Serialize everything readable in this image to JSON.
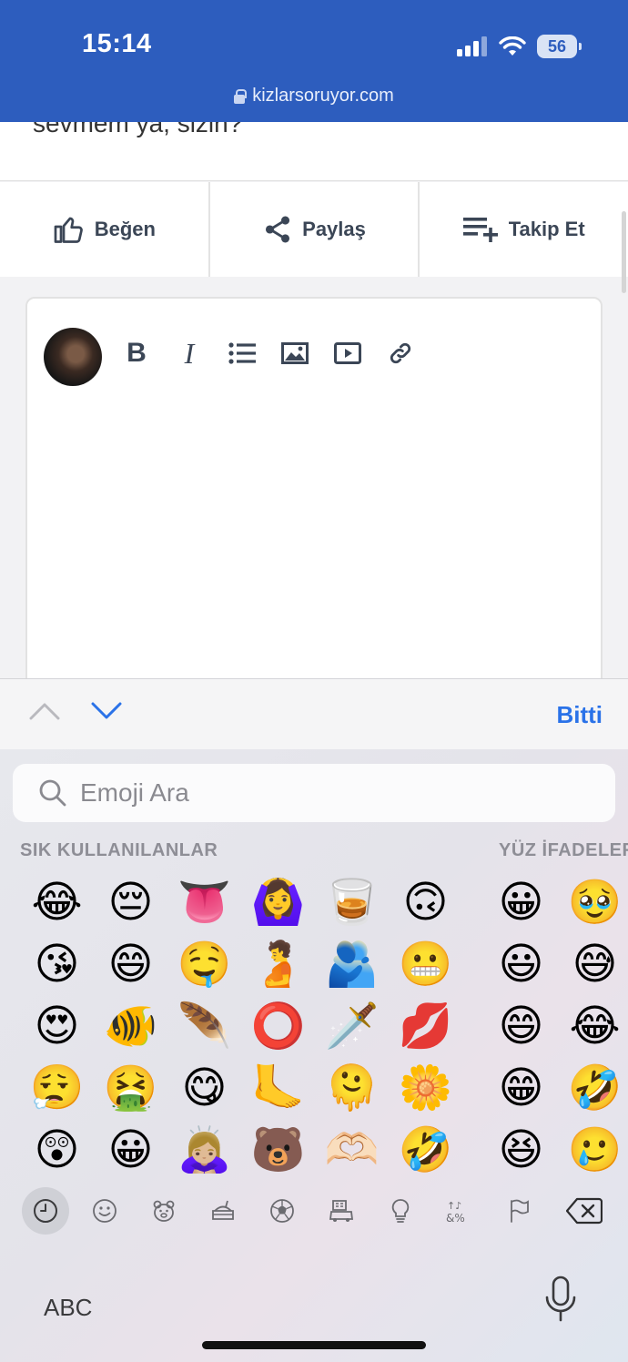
{
  "status_bar": {
    "time": "15:14",
    "battery": "56"
  },
  "browser": {
    "url": "kizlarsoruyor.com"
  },
  "page": {
    "partial_text": "sevmem ya, sizin?"
  },
  "actions": [
    {
      "label": "Beğen",
      "icon": "thumbs-up-icon"
    },
    {
      "label": "Paylaş",
      "icon": "share-icon"
    },
    {
      "label": "Takip Et",
      "icon": "playlist-add-icon"
    }
  ],
  "editor_toolbar": [
    "bold",
    "italic",
    "bulleted-list",
    "image",
    "video",
    "link"
  ],
  "editor_glyphs": {
    "bold": "B",
    "italic": "I"
  },
  "accessory": {
    "done_label": "Bitti"
  },
  "emoji_keyboard": {
    "search_placeholder": "Emoji Ara",
    "frequent_title": "SIK KULLANILANLAR",
    "faces_title": "YÜZ İFADELERİ",
    "frequent": [
      [
        "😂",
        "😔",
        "👅",
        "🙆‍♀️",
        "🥃",
        "🙃"
      ],
      [
        "😘",
        "😄",
        "🤤",
        "🫄",
        "🫂",
        "😬"
      ],
      [
        "😍",
        "🐠",
        "🪶",
        "⭕",
        "🗡️",
        "💋"
      ],
      [
        "😮‍💨",
        "🤮",
        "😋",
        "🦶",
        "🫠",
        "🌼"
      ],
      [
        "😲",
        "😀",
        "🙇🏼‍♀️",
        "🐻",
        "🫶🏻",
        "🤣"
      ]
    ],
    "faces": [
      [
        "😀",
        "🥹"
      ],
      [
        "😃",
        "😅"
      ],
      [
        "😄",
        "😂"
      ],
      [
        "😁",
        "🤣"
      ],
      [
        "😆",
        "🥲"
      ]
    ],
    "categories": [
      "recent-icon",
      "smiley-icon",
      "animal-icon",
      "food-icon",
      "sports-icon",
      "travel-icon",
      "objects-icon",
      "symbols-icon",
      "flag-icon"
    ],
    "abc_label": "ABC"
  },
  "colors": {
    "brand_blue": "#2d5dbe",
    "accent_blue": "#2a72e8"
  }
}
